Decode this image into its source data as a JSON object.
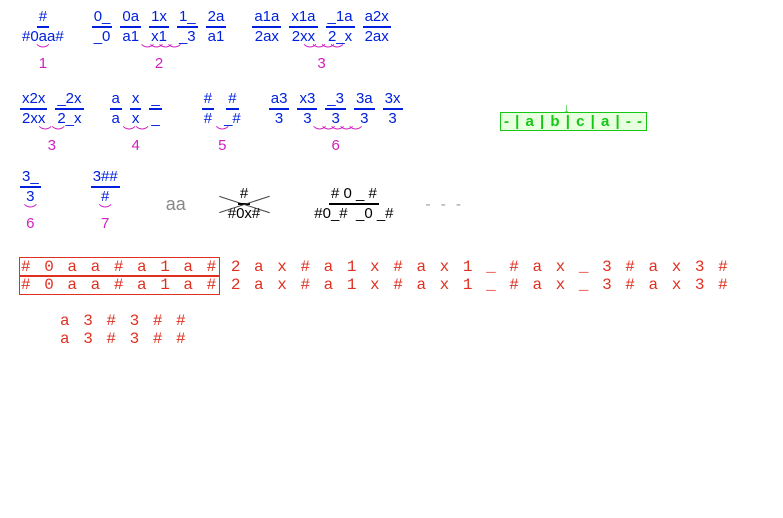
{
  "row1": {
    "g1": {
      "fracs": [
        {
          "n": "#",
          "d": "#0aa#"
        }
      ],
      "label": "1"
    },
    "g2": {
      "fracs": [
        {
          "n": "0_",
          "d": "_0"
        },
        {
          "n": "0a",
          "d": "a1"
        },
        {
          "n": "1x",
          "d": "x1"
        },
        {
          "n": "1_",
          "d": "_3"
        },
        {
          "n": "2a",
          "d": "a1"
        }
      ],
      "label": "2"
    },
    "g3": {
      "fracs": [
        {
          "n": "a1a",
          "d": "2ax"
        },
        {
          "n": "x1a",
          "d": "2xx"
        },
        {
          "n": "_1a",
          "d": "2_x"
        },
        {
          "n": "a2x",
          "d": "2ax"
        }
      ],
      "label": "3"
    }
  },
  "green_note": "- | a | b | c | a | - -",
  "row2": {
    "g3b": {
      "fracs": [
        {
          "n": "x2x",
          "d": "2xx"
        },
        {
          "n": "_2x",
          "d": "2_x"
        }
      ],
      "label": "3"
    },
    "g4": {
      "fracs": [
        {
          "n": "a",
          "d": "a"
        },
        {
          "n": "x",
          "d": "x"
        },
        {
          "n": "_",
          "d": "_"
        }
      ],
      "label": "4"
    },
    "g5": {
      "fracs": [
        {
          "n": "#",
          "d": "#"
        },
        {
          "n": "#",
          "d": "_#"
        }
      ],
      "label": "5"
    },
    "g6": {
      "fracs": [
        {
          "n": "a3",
          "d": "3"
        },
        {
          "n": "x3",
          "d": "3"
        },
        {
          "n": "_3",
          "d": "3"
        },
        {
          "n": "3a",
          "d": "3"
        },
        {
          "n": "3x",
          "d": "3"
        }
      ],
      "label": "6"
    }
  },
  "row3": {
    "g6b": {
      "fracs": [
        {
          "n": "3_",
          "d": "3"
        }
      ],
      "label": "6"
    },
    "g7": {
      "fracs": [
        {
          "n": "3##",
          "d": "#"
        }
      ],
      "label": "7"
    },
    "aa": "aa",
    "crossed": {
      "n": "#",
      "d": "#0x#"
    },
    "big": {
      "n": "# 0 _ #",
      "d": "#0_#  _0 _#"
    },
    "dashes": "- - -"
  },
  "trace": {
    "l1": "# 0 a a # a 1 a # 2 a x # a 1 x # a x 1 _ # a x _ 3 # a x 3 #",
    "l2": "# 0 a a # a 1 a # 2 a x # a 1 x # a x 1 _ # a x _ 3 # a x 3 #",
    "l3": "a 3 # 3 # #",
    "l4": "a 3 # 3 # #",
    "boxed_prefix": "# 0 a a # a 1 a #"
  }
}
